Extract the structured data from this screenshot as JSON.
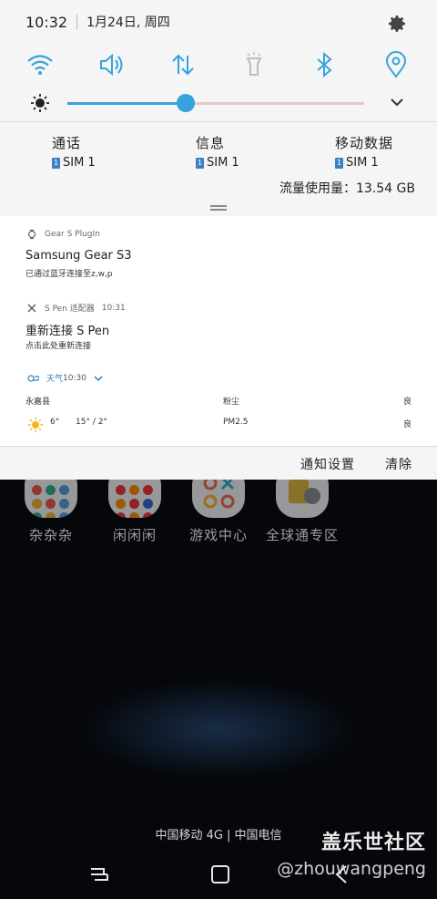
{
  "status_bar": {
    "time": "10:32",
    "date": "1月24日, 周四"
  },
  "quick_settings": {
    "tiles": [
      {
        "name": "wifi-icon",
        "active": true
      },
      {
        "name": "sound-icon",
        "active": true
      },
      {
        "name": "mobile-data-icon",
        "active": true
      },
      {
        "name": "flashlight-icon",
        "active": false
      },
      {
        "name": "bluetooth-icon",
        "active": true
      },
      {
        "name": "location-icon",
        "active": true
      }
    ],
    "brightness_level": 0.4,
    "accent_color": "#36a3dd"
  },
  "sim_panel": {
    "columns": [
      {
        "title": "通话",
        "sim": "SIM 1"
      },
      {
        "title": "信息",
        "sim": "SIM 1"
      },
      {
        "title": "移动数据",
        "sim": "SIM 1"
      }
    ],
    "data_usage": "流量使用量：13.54 GB"
  },
  "notifications": {
    "gear": {
      "app": "Gear S PlugIn",
      "title": "Samsung Gear S3",
      "text": "已通过蓝牙连接至z,w,p"
    },
    "spen": {
      "app": "S Pen 适配器",
      "time": "10:31",
      "title": "重新连接 S Pen",
      "text": "点击此处重新连接"
    },
    "weather": {
      "app": "天气",
      "time": "10:30",
      "location": "永嘉县",
      "dust_label": "粉尘",
      "dust_value": "良",
      "temp": "6°",
      "range": "15° / 2°",
      "pm_label": "PM2.5",
      "pm_value": "良"
    }
  },
  "actions": {
    "settings": "通知设置",
    "clear": "清除"
  },
  "home_apps": [
    {
      "label": "杂杂杂"
    },
    {
      "label": "闲闲闲"
    },
    {
      "label": "游戏中心"
    },
    {
      "label": "全球通专区"
    }
  ],
  "carrier": "中国移动 4G | 中国电信",
  "watermark": {
    "title": "盖乐世社区",
    "user": "@zhouwangpeng"
  }
}
